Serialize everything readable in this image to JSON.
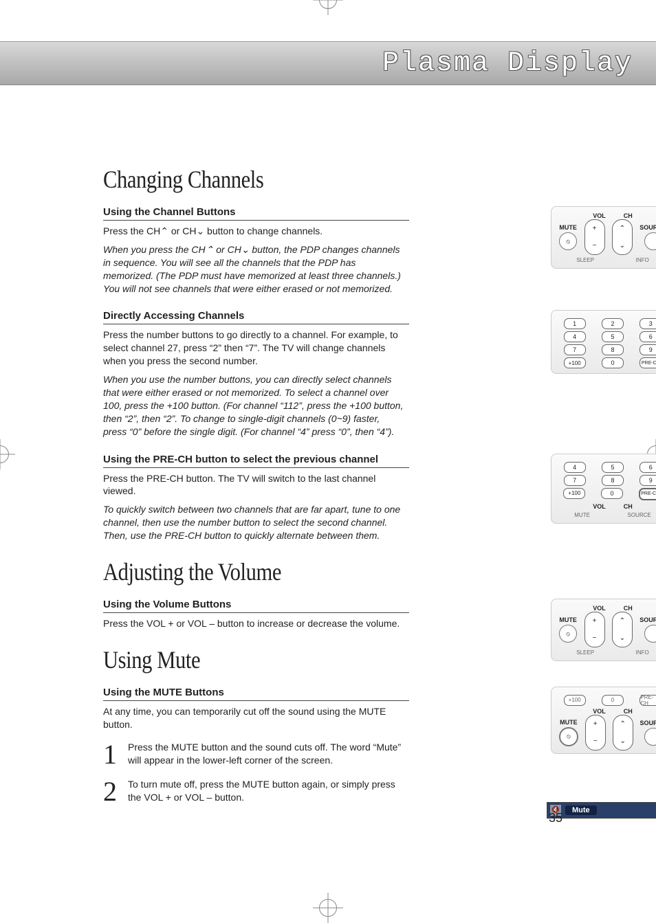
{
  "header": {
    "title": "Plasma Display"
  },
  "page_number": "35",
  "sections": {
    "changing": {
      "heading": "Changing Channels",
      "channel_buttons": {
        "sub": "Using the Channel Buttons",
        "line1a": "Press the CH",
        "line1b": " or CH",
        "line1c": " button to change channels.",
        "italic1a": "When you press the CH",
        "italic1b": " or CH",
        "italic1c": " button, the PDP changes channels in sequence. You will see all the channels that the PDP has memorized. (The PDP must have memorized at least three channels.)",
        "italic2": "You will not see channels that were either erased or not memorized."
      },
      "direct": {
        "sub": "Directly Accessing Channels",
        "body": "Press the number buttons to go directly to a channel. For example, to select channel 27, press “2” then “7”. The TV will change channels when you press the second number.",
        "italic": "When you use the number buttons, you can directly select channels that were either erased or not memorized. To select a channel over 100, press the +100 button. (For channel “112”, press the +100 button, then “2”, then “2”. To change to single-digit channels (0~9) faster, press “0” before the single digit. (For channel “4” press “0”, then “4”)."
      },
      "prech": {
        "sub": "Using the PRE-CH button to select the previous channel",
        "body": "Press the PRE-CH button. The TV will switch to the last channel viewed.",
        "italic": "To quickly switch between two channels that are far apart, tune to one channel, then use the number button to select the second channel. Then, use the PRE-CH button to quickly alternate between them."
      }
    },
    "volume": {
      "heading": "Adjusting the Volume",
      "sub": "Using the Volume Buttons",
      "body": "Press the VOL + or VOL – button to increase or decrease the volume."
    },
    "mute": {
      "heading": "Using Mute",
      "sub": "Using the MUTE Buttons",
      "body": "At any time, you can temporarily cut off the sound using the MUTE button.",
      "step1": "Press the MUTE button and the sound cuts off. The word “Mute” will appear in the lower-left corner of the screen.",
      "step2": "To turn mute off, press the MUTE button again, or simply press the VOL + or VOL – button.",
      "osd_label": "Mute"
    }
  },
  "remote": {
    "labels": {
      "mute": "MUTE",
      "source": "SOURCE",
      "vol": "VOL",
      "ch": "CH",
      "sleep": "SLEEP",
      "info": "INFO",
      "prech": "PRE-CH",
      "plus100": "+100"
    },
    "glyphs": {
      "plus": "+",
      "minus": "−",
      "up": "⌃",
      "down": "⌄",
      "mute_icon": "⦸"
    },
    "numbers": {
      "n0": "0",
      "n1": "1",
      "n2": "2",
      "n3": "3",
      "n4": "4",
      "n5": "5",
      "n6": "6",
      "n7": "7",
      "n8": "8",
      "n9": "9"
    },
    "steps": {
      "one": "1",
      "two": "2"
    }
  }
}
